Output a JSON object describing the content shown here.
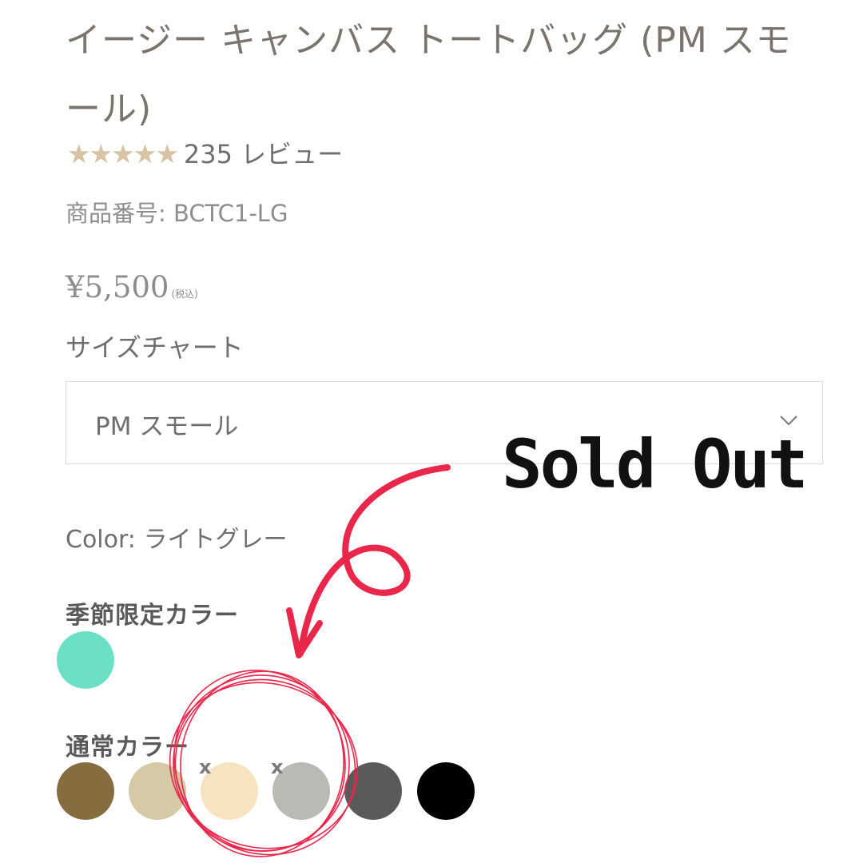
{
  "product": {
    "title": "イージー キャンバス トートバッグ (PM スモール)",
    "rating_stars": "★★★★★",
    "review_count": "235 レビュー",
    "sku": "商品番号: BCTC1-LG",
    "price": "¥5,500",
    "price_tax_note": "(税込)"
  },
  "size": {
    "label": "サイズチャート",
    "selected": "PM スモール"
  },
  "color": {
    "current_label": "Color: ライトグレー",
    "seasonal_title": "季節限定カラー",
    "seasonal_swatches": [
      {
        "color": "#6ce0c6",
        "sold_out": false
      }
    ],
    "regular_title": "通常カラー",
    "regular_swatches": [
      {
        "color": "#856d40",
        "sold_out": false
      },
      {
        "color": "#d6caa6",
        "sold_out": false
      },
      {
        "color": "#f6e4c1",
        "sold_out": true,
        "mark": "x"
      },
      {
        "color": "#b9bab3",
        "sold_out": true,
        "mark": "x"
      },
      {
        "color": "#5a5a5a",
        "sold_out": false
      },
      {
        "color": "#000000",
        "sold_out": false
      }
    ]
  },
  "annotation": {
    "text": "Sold Out",
    "accent_color": "#e8274b"
  }
}
